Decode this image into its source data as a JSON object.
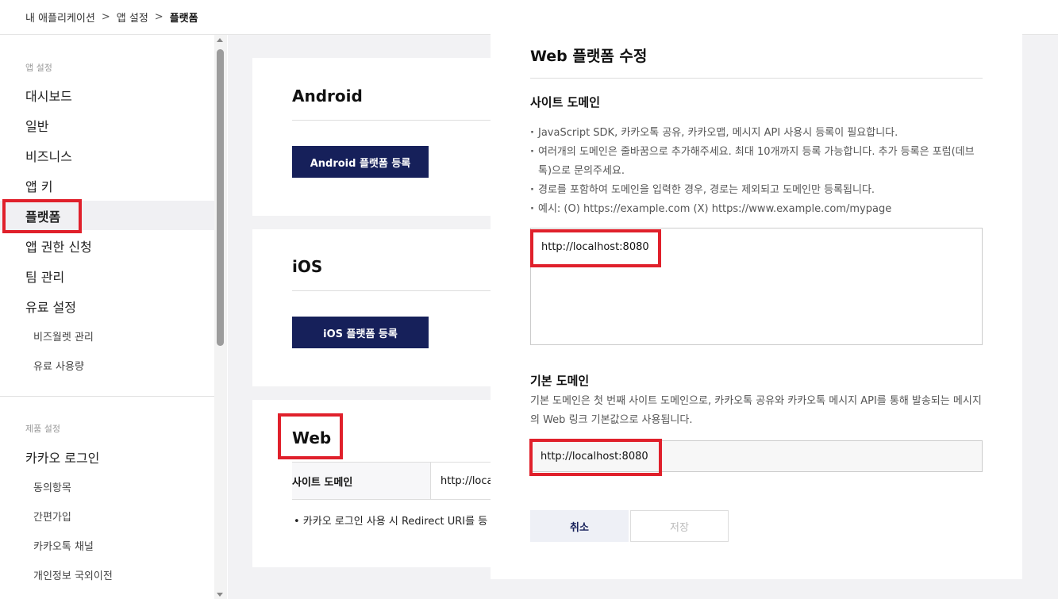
{
  "breadcrumb": {
    "items": [
      "내 애플리케이션",
      "앱 설정"
    ],
    "separator": ">",
    "current": "플랫폼"
  },
  "sidebar": {
    "section_app": "앱 설정",
    "items": [
      "대시보드",
      "일반",
      "비즈니스",
      "앱 키",
      "플랫폼",
      "앱 권한 신청",
      "팀 관리",
      "유료 설정"
    ],
    "active_item": "플랫폼",
    "sub_items": [
      "비즈월렛 관리",
      "유료 사용량"
    ],
    "section_product": "제품 설정",
    "product_item": "카카오 로그인",
    "product_sub_items": [
      "동의항목",
      "간편가입",
      "카카오톡 채널",
      "개인정보 국외이전"
    ]
  },
  "main": {
    "android": {
      "title": "Android",
      "button": "Android 플랫폼 등록"
    },
    "ios": {
      "title": "iOS",
      "button": "iOS 플랫폼 등록"
    },
    "web": {
      "title": "Web",
      "site_domain_label": "사이트 도메인",
      "site_domain_value": "http://loca",
      "note": "• 카카오 로그인 사용 시 Redirect URI를 등"
    }
  },
  "modal": {
    "title": "Web 플랫폼 수정",
    "site_domain_heading": "사이트 도메인",
    "bullets": [
      "JavaScript SDK, 카카오톡 공유, 카카오맵, 메시지 API 사용시 등록이 필요합니다.",
      "여러개의 도메인은 줄바꿈으로 추가해주세요. 최대 10개까지 등록 가능합니다. 추가 등록은 포럼(데브톡)으로 문의주세요.",
      "경로를 포함하여 도메인을 입력한 경우, 경로는 제외되고 도메인만 등록됩니다.",
      "예시: (O) https://example.com (X) https://www.example.com/mypage"
    ],
    "site_domain_value": "http://localhost:8080",
    "default_domain_heading": "기본 도메인",
    "default_domain_desc": "기본 도메인은 첫 번째 사이트 도메인으로, 카카오톡 공유와 카카오톡 메시지 API를 통해 발송되는 메시지의 Web 링크 기본값으로 사용됩니다.",
    "default_domain_value": "http://localhost:8080",
    "cancel_label": "취소",
    "save_label": "저장"
  },
  "colors": {
    "primary": "#16205a",
    "highlight": "#e0202b",
    "content_bg": "#f2f2f4"
  }
}
